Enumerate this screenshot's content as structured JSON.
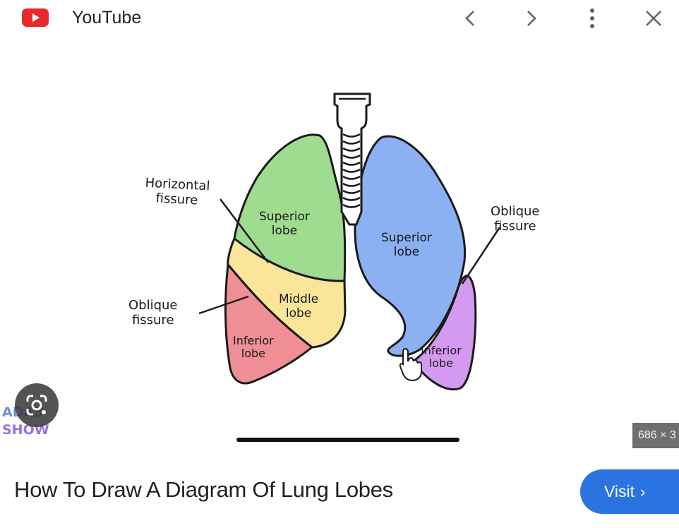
{
  "header": {
    "source": "YouTube",
    "icons": [
      "youtube-logo-icon",
      "chevron-left-icon",
      "chevron-right-icon",
      "more-vert-icon",
      "close-icon"
    ]
  },
  "diagram": {
    "labels": {
      "horizontal_fissure": "Horizontal\nfissure",
      "left_oblique_fissure": "Oblique\nfissure",
      "right_oblique_fissure": "Oblique\nfissure",
      "left_superior": "Superior\nlobe",
      "middle": "Middle\nlobe",
      "left_inferior": "Inferior\nlobe",
      "right_superior": "Superior\nlobe",
      "right_inferior": "Inferior\nlobe"
    },
    "colors": {
      "superior_left": "#9fdc8f",
      "middle": "#fae59a",
      "inferior_left": "#ef8f95",
      "superior_right": "#8bb1f3",
      "inferior_right": "#d49af0",
      "trachea": "#ffffff"
    }
  },
  "watermark": {
    "line1": "ADAS",
    "line2": "SHOW"
  },
  "dimensions_badge": "686 × 3",
  "title": "How To Draw A Diagram Of Lung Lobes",
  "visit": {
    "label": "Visit"
  }
}
